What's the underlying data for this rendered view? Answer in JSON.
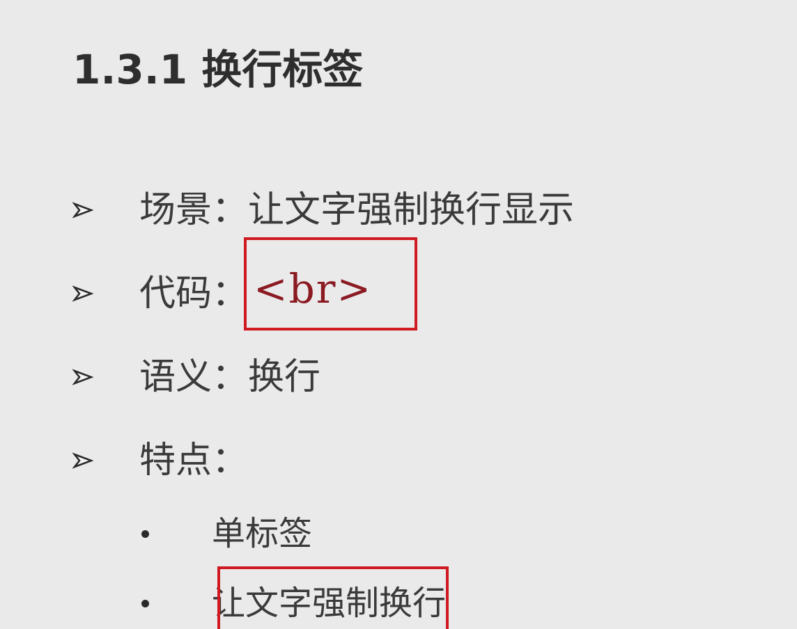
{
  "slide": {
    "title": "1.3.1 换行标签",
    "bullets": [
      {
        "label": "场景：让文字强制换行显示"
      },
      {
        "label": "代码："
      },
      {
        "label": "语义：换行"
      },
      {
        "label": "特点："
      }
    ],
    "code": "<br>",
    "sub_bullets": [
      {
        "label": "单标签"
      },
      {
        "label": "让文字强制换行"
      }
    ]
  },
  "colors": {
    "background": "#eaeaea",
    "text": "#3a3a3a",
    "highlight_border": "#d01a22",
    "code_text": "#8b1a22"
  },
  "icons": {
    "bullet_arrow": "arrowhead-icon",
    "sub_bullet": "dot-icon"
  }
}
